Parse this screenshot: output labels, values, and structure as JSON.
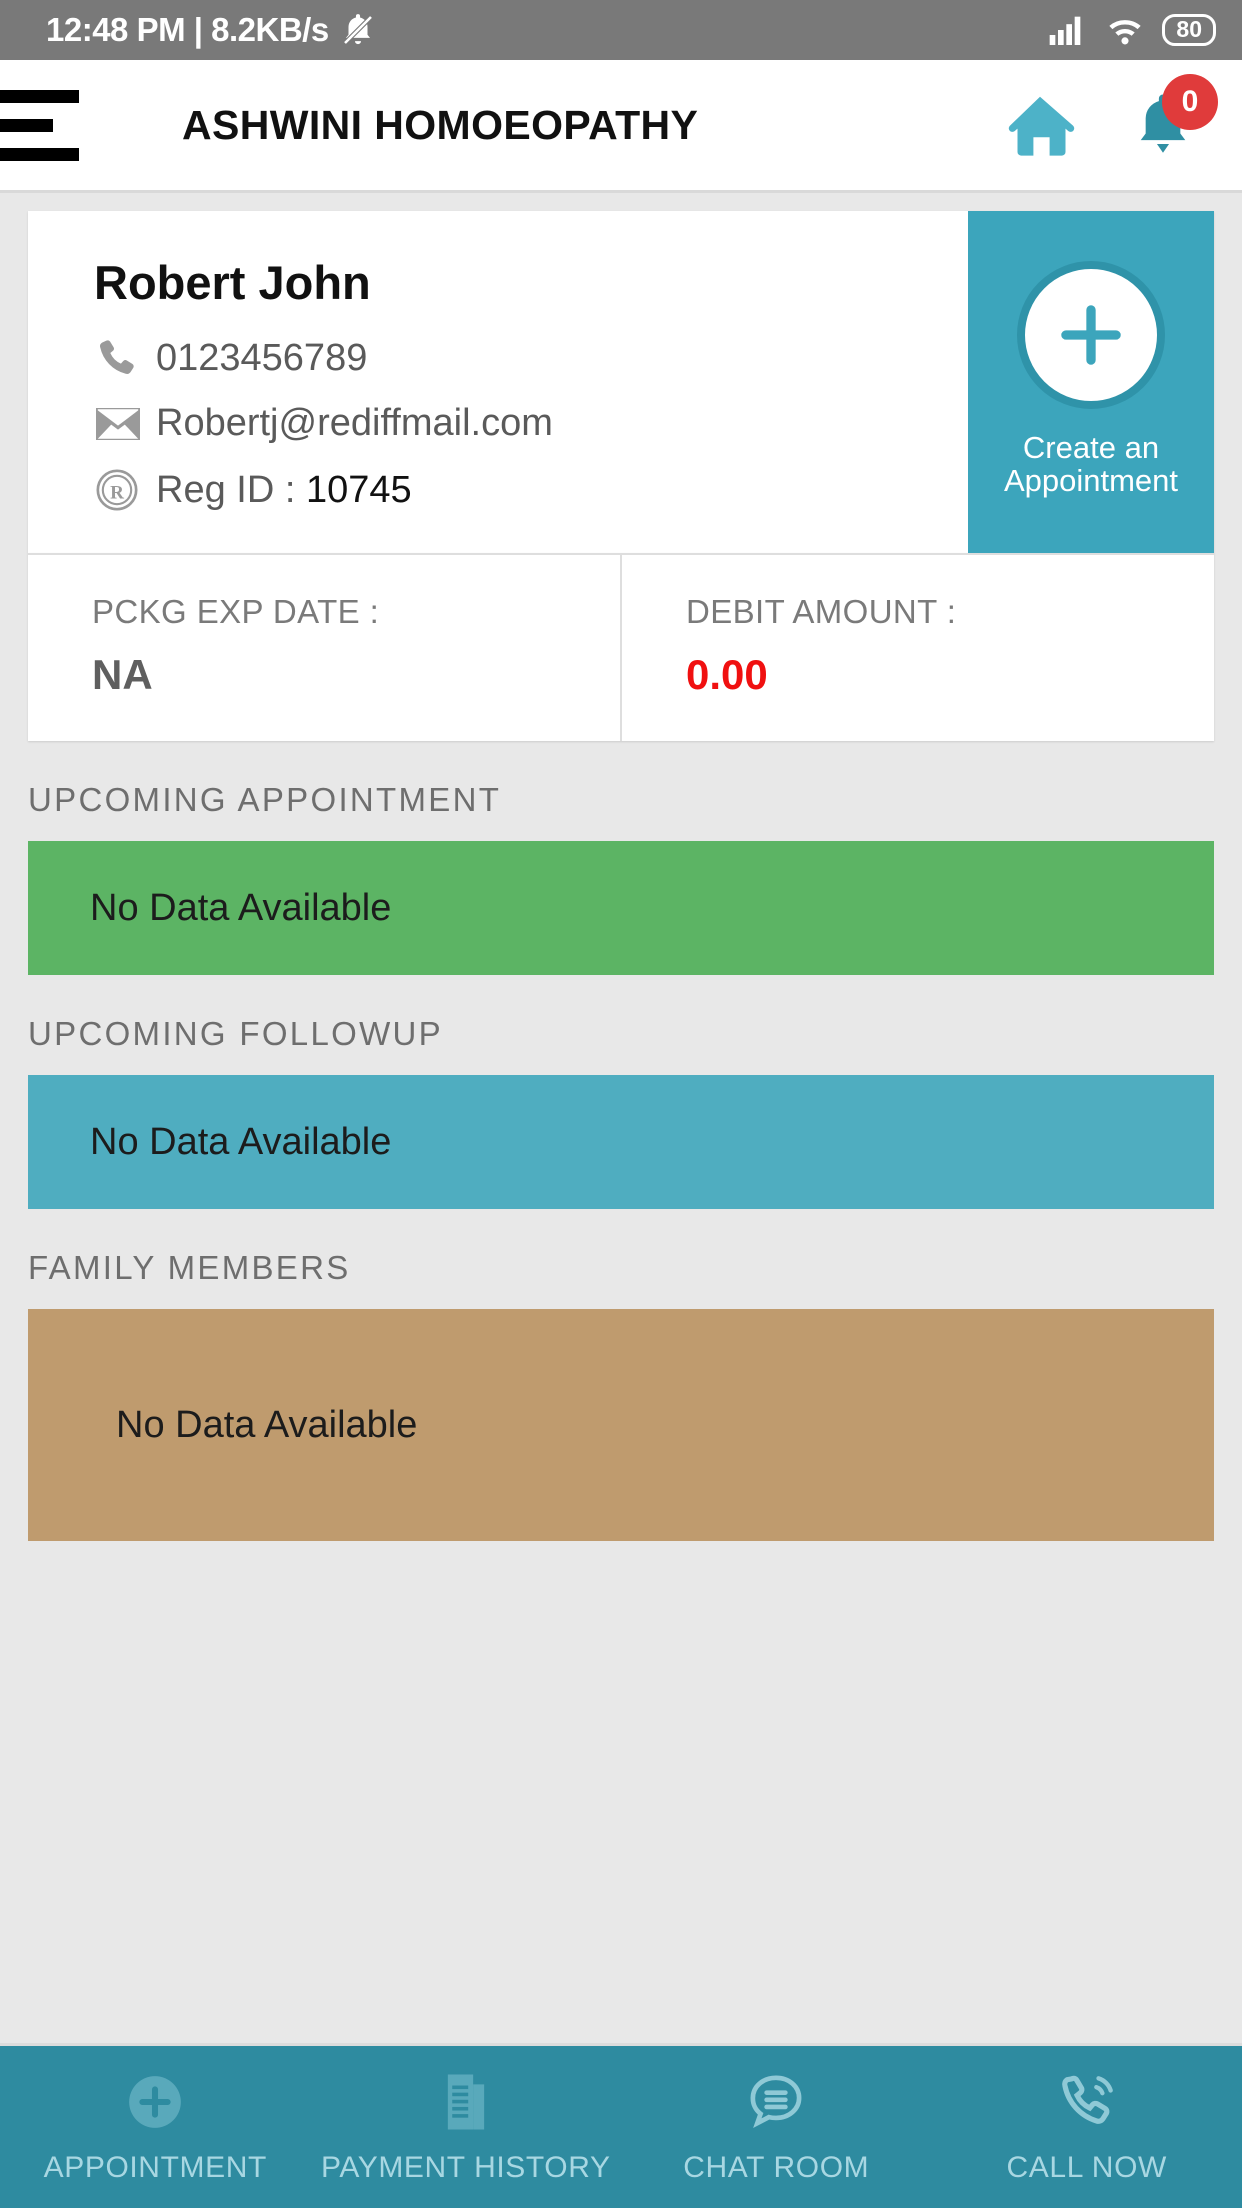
{
  "status_bar": {
    "time_and_speed": "12:48 PM | 8.2KB/s",
    "mute_icon": "bell-muted-icon",
    "signal_icon": "signal-bars-icon",
    "wifi_icon": "wifi-icon",
    "battery_level": "80"
  },
  "app_bar": {
    "menu_icon": "hamburger-menu-icon",
    "title": "ASHWINI HOMOEOPATHY",
    "home_icon": "home-icon",
    "notification_icon": "bell-icon",
    "notification_count": "0"
  },
  "patient_card": {
    "name": "Robert John",
    "phone_icon": "phone-icon",
    "phone": "0123456789",
    "email_icon": "envelope-icon",
    "email": "Robertj@rediffmail.com",
    "reg_icon": "registered-mark-icon",
    "reg_label": "Reg ID :",
    "reg_id": "10745",
    "cta": {
      "plus_icon": "plus-icon",
      "line1": "Create an",
      "line2": "Appointment"
    }
  },
  "meta": [
    {
      "label": "PCKG EXP DATE :",
      "value": "NA",
      "color": "#5f5f5f"
    },
    {
      "label": "DEBIT AMOUNT :",
      "value": "0.00",
      "color": "#f01010"
    }
  ],
  "sections": [
    {
      "title": "UPCOMING APPOINTMENT",
      "empty_text": "No Data Available",
      "color": "#5cb464"
    },
    {
      "title": "UPCOMING FOLLOWUP",
      "empty_text": "No Data Available",
      "color": "#4fadc0"
    },
    {
      "title": "FAMILY MEMBERS",
      "empty_text": "No Data Available",
      "color": "#bf9b6e"
    }
  ],
  "bottom_nav": [
    {
      "label": "APPOINTMENT",
      "icon": "plus-circle-icon"
    },
    {
      "label": "PAYMENT HISTORY",
      "icon": "invoice-icon"
    },
    {
      "label": "CHAT ROOM",
      "icon": "chat-bubble-icon"
    },
    {
      "label": "CALL NOW",
      "icon": "phone-call-icon"
    }
  ],
  "theme": {
    "accent_teal": "#3ca5bc",
    "nav_teal": "#2e8ba0",
    "badge_red": "#e03b3b",
    "page_bg": "#e8e8e8"
  }
}
